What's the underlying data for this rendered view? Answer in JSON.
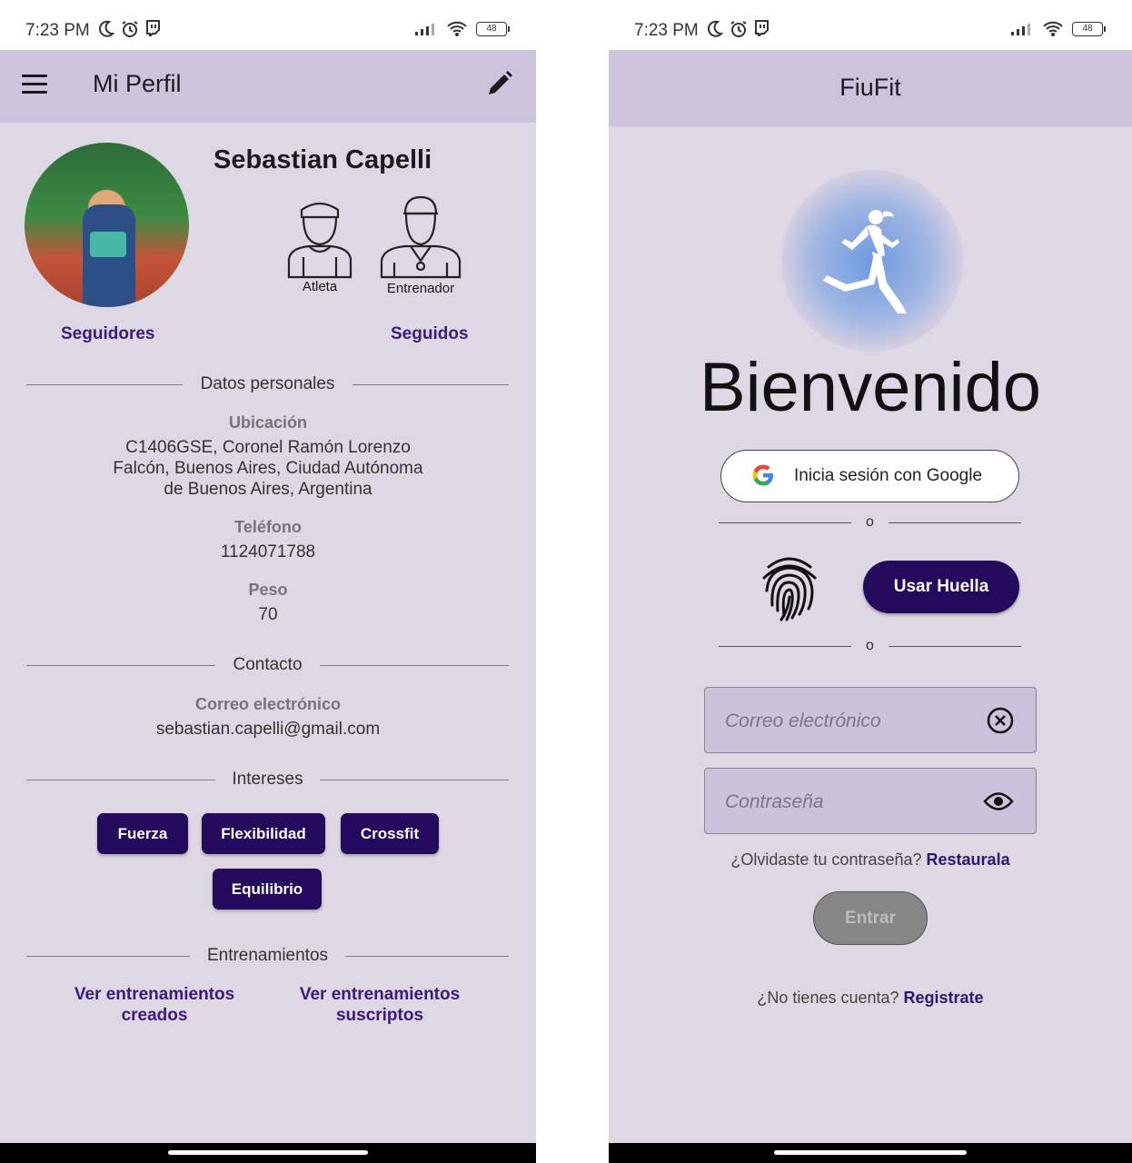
{
  "status_bar": {
    "time": "7:23 PM",
    "battery": "48"
  },
  "profile": {
    "title": "Mi Perfil",
    "name": "Sebastian Capelli",
    "roles": [
      "Atleta",
      "Entrenador"
    ],
    "followers_label": "Seguidores",
    "following_label": "Seguidos",
    "personal_section": "Datos personales",
    "location_label": "Ubicación",
    "location_value": "C1406GSE, Coronel Ramón Lorenzo Falcón, Buenos Aires, Ciudad Autónoma de Buenos Aires, Argentina",
    "phone_label": "Teléfono",
    "phone_value": "1124071788",
    "weight_label": "Peso",
    "weight_value": "70",
    "contact_section": "Contacto",
    "email_label": "Correo electrónico",
    "email_value": "sebastian.capelli@gmail.com",
    "interests_section": "Intereses",
    "interests": [
      "Fuerza",
      "Flexibilidad",
      "Crossfit",
      "Equilibrio"
    ],
    "trainings_section": "Entrenamientos",
    "trainings_created": "Ver entrenamientos creados",
    "trainings_subscribed": "Ver entrenamientos suscriptos"
  },
  "login": {
    "app_title": "FiuFit",
    "welcome": "Bienvenido",
    "google_button": "Inicia sesión con Google",
    "or": "o",
    "fingerprint_button": "Usar Huella",
    "email_placeholder": "Correo electrónico",
    "password_placeholder": "Contraseña",
    "forgot_text": "¿Olvidaste tu contraseña?",
    "forgot_link": "Restaurala",
    "submit_button": "Entrar",
    "no_account_text": "¿No tienes cuenta?",
    "register_link": "Registrate"
  },
  "colors": {
    "appbar": "#cdc3dd",
    "background": "#ddd8e3",
    "primary": "#230a5c",
    "link": "#3b1a7a",
    "disabled_button": "#868686"
  },
  "icons": [
    "menu-icon",
    "edit-icon",
    "athlete-icon",
    "coach-icon",
    "runner-icon",
    "google-icon",
    "fingerprint-icon",
    "clear-icon",
    "eye-icon"
  ]
}
